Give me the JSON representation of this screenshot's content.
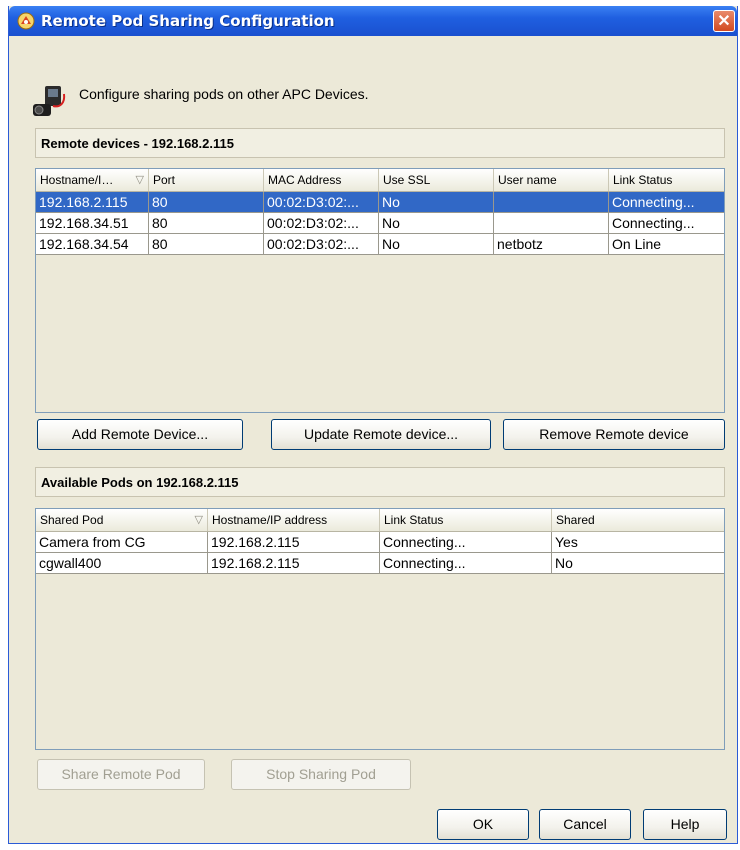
{
  "window": {
    "title": "Remote Pod Sharing Configuration",
    "close_glyph": "✕"
  },
  "intro": {
    "text": "Configure sharing pods on other APC Devices.",
    "icon": "camera-pod-icon"
  },
  "remote_devices": {
    "header": "Remote devices - 192.168.2.115",
    "columns": [
      "Hostname/I…",
      "Port",
      "MAC Address",
      "Use SSL",
      "User name",
      "Link Status"
    ],
    "rows": [
      {
        "selected": true,
        "cells": [
          "192.168.2.115",
          "80",
          "00:02:D3:02:...",
          "No",
          "",
          "Connecting..."
        ]
      },
      {
        "selected": false,
        "cells": [
          "192.168.34.51",
          "80",
          "00:02:D3:02:...",
          "No",
          "",
          "Connecting..."
        ]
      },
      {
        "selected": false,
        "cells": [
          "192.168.34.54",
          "80",
          "00:02:D3:02:...",
          "No",
          "netbotz",
          "On Line"
        ]
      }
    ],
    "buttons": {
      "add": "Add Remote Device...",
      "update": "Update Remote device...",
      "remove": "Remove Remote device"
    }
  },
  "available_pods": {
    "header": "Available Pods on 192.168.2.115",
    "columns": [
      "Shared Pod",
      "Hostname/IP address",
      "Link Status",
      "Shared"
    ],
    "rows": [
      {
        "cells": [
          "Camera from CG",
          "192.168.2.115",
          "Connecting...",
          "Yes"
        ]
      },
      {
        "cells": [
          "cgwall400",
          "192.168.2.115",
          "Connecting...",
          "No"
        ]
      }
    ],
    "buttons": {
      "share": "Share Remote Pod",
      "stop": "Stop Sharing Pod"
    }
  },
  "footer": {
    "ok": "OK",
    "cancel": "Cancel",
    "help": "Help"
  },
  "colors": {
    "titlebar": "#1f5fe0",
    "selection": "#3168c6",
    "dialog_bg": "#ece9d8"
  }
}
